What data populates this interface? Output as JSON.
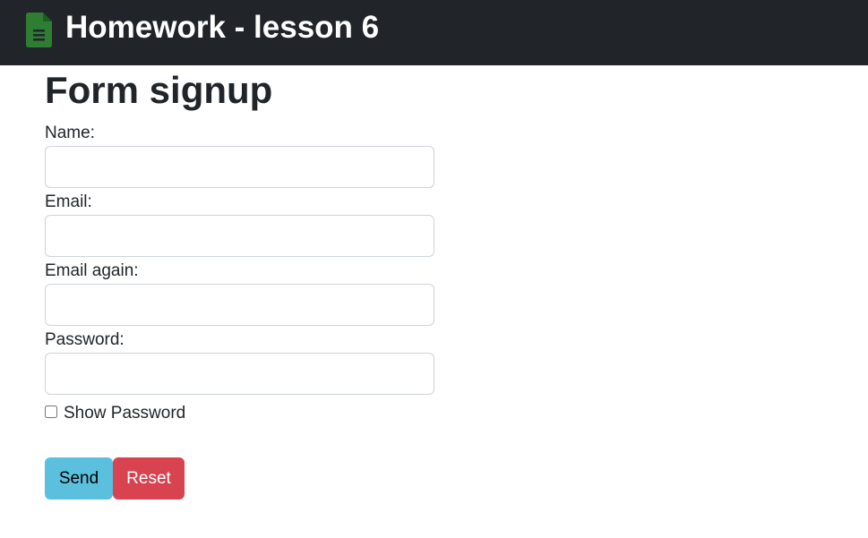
{
  "navbar": {
    "title": "Homework - lesson 6",
    "icon": "document-icon",
    "background": "#212529",
    "icon_color": "#2e7d32"
  },
  "main": {
    "title": "Form signup",
    "fields": [
      {
        "label": "Name:",
        "value": "",
        "placeholder": ""
      },
      {
        "label": "Email:",
        "value": "",
        "placeholder": ""
      },
      {
        "label": "Email again:",
        "value": "",
        "placeholder": ""
      },
      {
        "label": "Password:",
        "value": "",
        "placeholder": ""
      }
    ],
    "show_password": {
      "label": "Show Password",
      "checked": false
    },
    "buttons": {
      "send": {
        "label": "Send",
        "color": "#5bc0de",
        "text_color": "#000000"
      },
      "reset": {
        "label": "Reset",
        "color": "#d9424f",
        "text_color": "#ffffff"
      }
    }
  }
}
